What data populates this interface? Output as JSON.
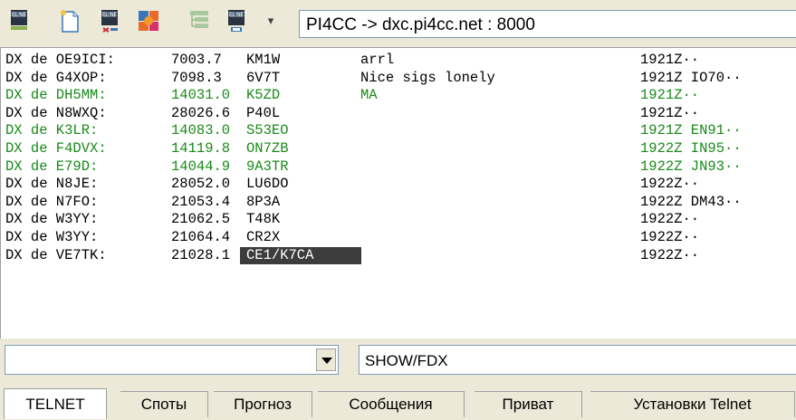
{
  "toolbar": {
    "icons": [
      {
        "name": "telnet-connect-icon",
        "label": "TEL NET"
      },
      {
        "name": "new-document-icon"
      },
      {
        "name": "telnet-disconnect-icon",
        "label": "TEL NET"
      },
      {
        "name": "hamfest-icon"
      },
      {
        "name": "tree-view-icon"
      },
      {
        "name": "telnet-settings-icon",
        "label": "TEL NET"
      }
    ],
    "cluster_address": "PI4CC -> dxc.pi4cc.net : 8000"
  },
  "spots": [
    {
      "from": "DX de OE9ICI:",
      "freq": "7003.7",
      "dx": "KM1W",
      "comment": "arrl",
      "time": "1921Z··",
      "color": "black"
    },
    {
      "from": "DX de G4XOP:",
      "freq": "7098.3",
      "dx": "6V7T",
      "comment": "Nice sigs lonely",
      "time": "1921Z IO70··",
      "color": "black"
    },
    {
      "from": "DX de DH5MM:",
      "freq": "14031.0",
      "dx": "K5ZD",
      "comment": "MA",
      "time": "1921Z··",
      "color": "green"
    },
    {
      "from": "DX de N8WXQ:",
      "freq": "28026.6",
      "dx": "P40L",
      "comment": "",
      "time": "1921Z··",
      "color": "black"
    },
    {
      "from": "DX de K3LR:",
      "freq": "14083.0",
      "dx": "S53EO",
      "comment": "",
      "time": "1921Z EN91··",
      "color": "green"
    },
    {
      "from": "DX de F4DVX:",
      "freq": "14119.8",
      "dx": "ON7ZB",
      "comment": "",
      "time": "1922Z IN95··",
      "color": "green"
    },
    {
      "from": "DX de E79D:",
      "freq": "14044.9",
      "dx": "9A3TR",
      "comment": "",
      "time": "1922Z JN93··",
      "color": "green"
    },
    {
      "from": "DX de N8JE:",
      "freq": "28052.0",
      "dx": "LU6DO",
      "comment": "",
      "time": "1922Z··",
      "color": "black"
    },
    {
      "from": "DX de N7FO:",
      "freq": "21053.4",
      "dx": "8P3A",
      "comment": "",
      "time": "1922Z DM43··",
      "color": "black"
    },
    {
      "from": "DX de W3YY:",
      "freq": "21062.5",
      "dx": "T48K",
      "comment": "",
      "time": "1922Z··",
      "color": "black"
    },
    {
      "from": "DX de W3YY:",
      "freq": "21064.4",
      "dx": "CR2X",
      "comment": "",
      "time": "1922Z··",
      "color": "black"
    },
    {
      "from": "DX de VE7TK:",
      "freq": "21028.1",
      "dx": "CE1/K7CA",
      "comment": "",
      "time": "1922Z··",
      "color": "black",
      "selected": true
    }
  ],
  "command": {
    "history_value": "",
    "input_value": "SHOW/FDX"
  },
  "tabs": [
    {
      "label": "TELNET",
      "active": true
    },
    {
      "label": "Споты"
    },
    {
      "label": "Прогноз"
    },
    {
      "label": "Сообщения"
    },
    {
      "label": "Приват"
    },
    {
      "label": "Установки Telnet"
    }
  ],
  "colors": {
    "spot_green": "#1A8A1A",
    "selection_bg": "#3C3C3C",
    "window_bg": "#ECE9D8"
  }
}
